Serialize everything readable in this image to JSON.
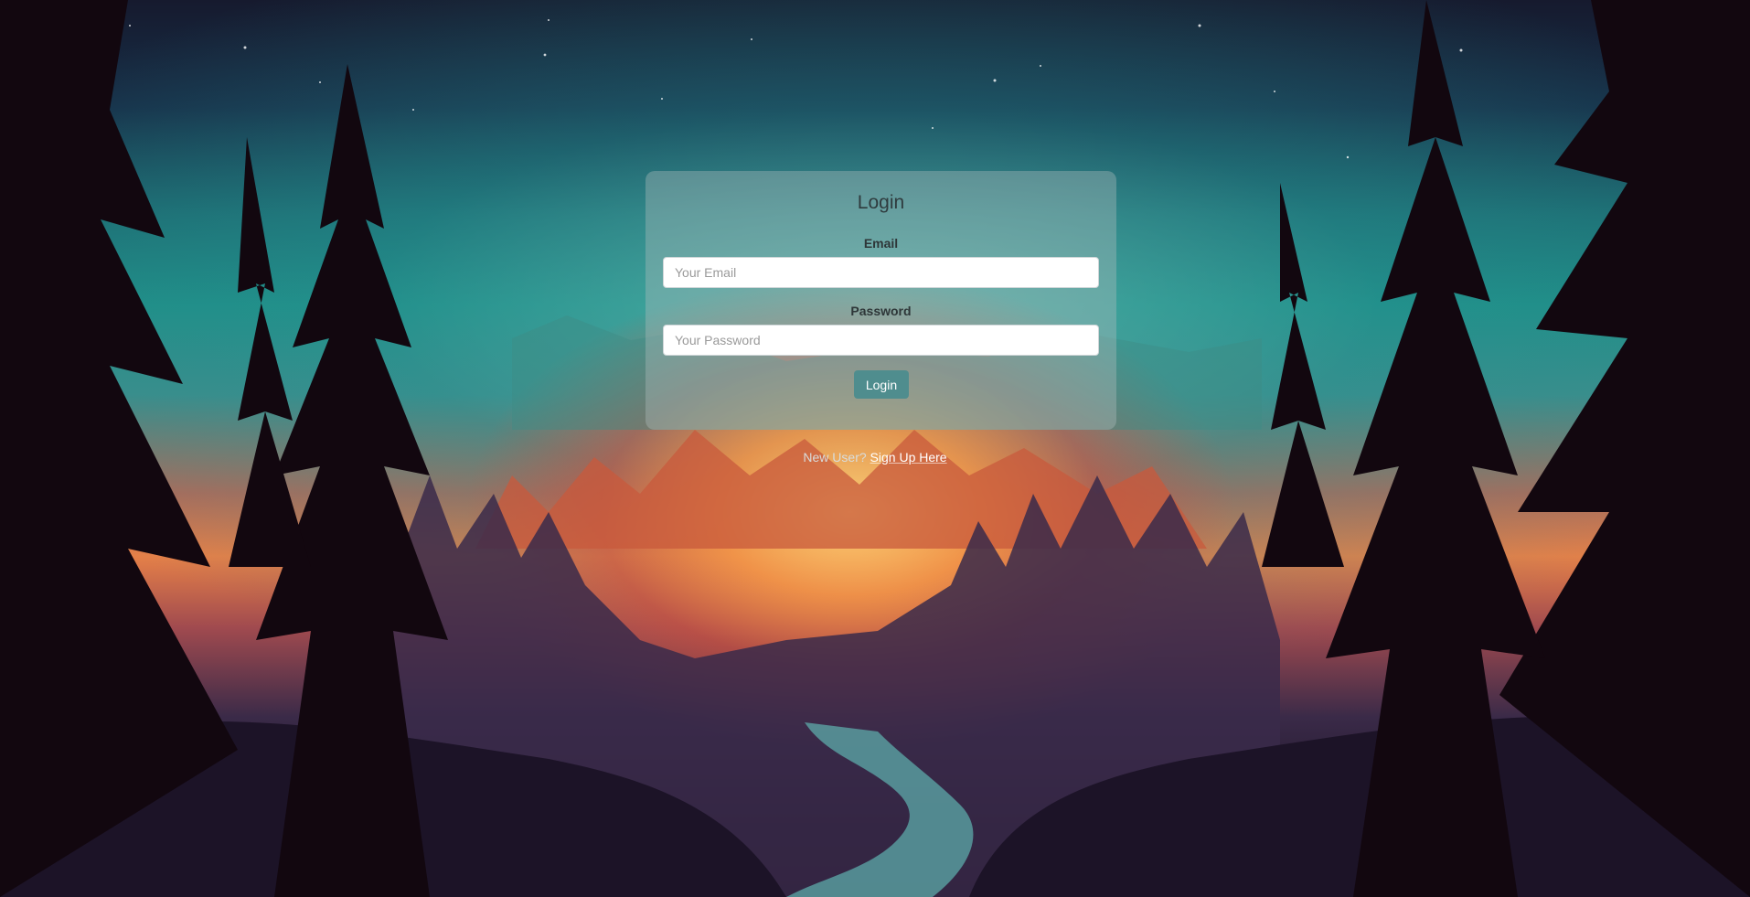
{
  "login": {
    "title": "Login",
    "email_label": "Email",
    "email_placeholder": "Your Email",
    "email_value": "",
    "password_label": "Password",
    "password_placeholder": "Your Password",
    "password_value": "",
    "submit_label": "Login"
  },
  "signup": {
    "prompt": "New User?",
    "link_label": "Sign Up Here"
  },
  "colors": {
    "button": "#4f8d8e",
    "card": "rgba(175,190,190,0.38)"
  }
}
